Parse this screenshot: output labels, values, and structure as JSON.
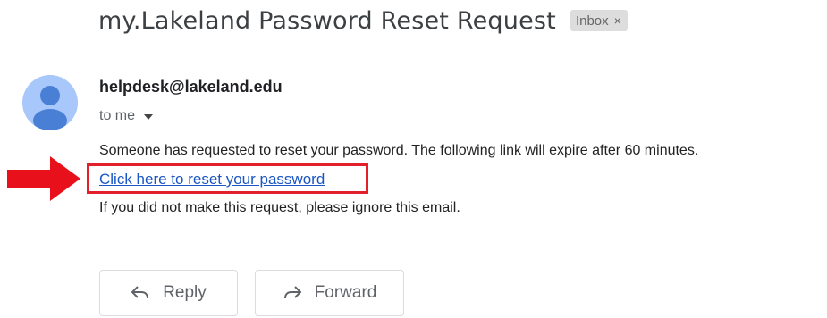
{
  "email": {
    "subject": "my.Lakeland Password Reset Request",
    "label": "Inbox",
    "label_close": "×",
    "sender": "helpdesk@lakeland.edu",
    "recipient": "to me",
    "body": {
      "line1": "Someone has requested to reset your password. The following link will expire after 60 minutes.",
      "link_text": "Click here to reset your password",
      "line3": "If you did not make this request, please ignore this email."
    }
  },
  "actions": {
    "reply_label": "Reply",
    "forward_label": "Forward"
  },
  "icons": {
    "avatar": "person-icon",
    "recipient_caret": "caret-down-icon",
    "highlight_arrow": "arrow-right-icon",
    "reply": "reply-icon",
    "forward": "forward-icon"
  },
  "colors": {
    "avatar_background": "#a8c7fa",
    "avatar_figure": "#4a7fd6",
    "link": "#1a56c4",
    "highlight": "#e1202a",
    "label_chip": "#dddddd"
  }
}
